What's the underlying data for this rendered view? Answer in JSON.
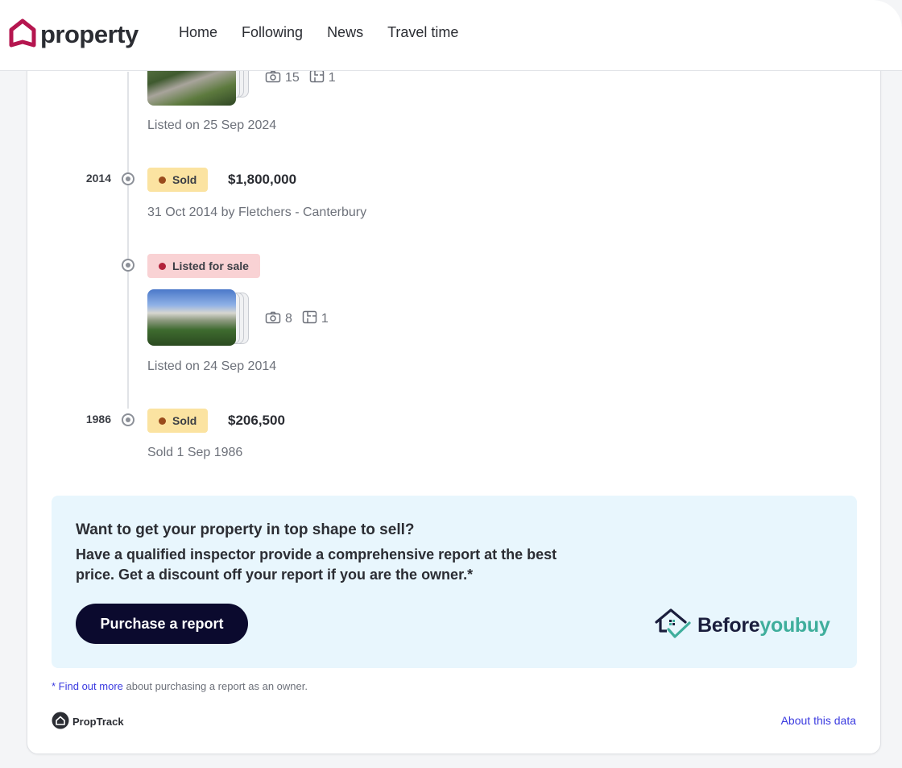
{
  "header": {
    "logo_text": "property",
    "nav": [
      "Home",
      "Following",
      "News",
      "Travel time"
    ]
  },
  "timeline": {
    "top_entry": {
      "photo_count": "15",
      "floorplan_count": "1",
      "listed_text": "Listed on 25 Sep 2024"
    },
    "sold_2014": {
      "year": "2014",
      "badge": "Sold",
      "price": "$1,800,000",
      "detail": "31 Oct 2014 by Fletchers - Canterbury"
    },
    "listed_2014": {
      "badge": "Listed for sale",
      "photo_count": "8",
      "floorplan_count": "1",
      "listed_text": "Listed on 24 Sep 2014"
    },
    "sold_1986": {
      "year": "1986",
      "badge": "Sold",
      "price": "$206,500",
      "detail": "Sold 1 Sep 1986"
    }
  },
  "promo": {
    "title": "Want to get your property in top shape to sell?",
    "body": "Have a qualified inspector provide a comprehensive report at the best price. Get a discount off your report if you are the owner.*",
    "button": "Purchase a report",
    "brand_before": "Before",
    "brand_youbuy": "youbuy"
  },
  "footer": {
    "footnote_star": "* ",
    "footnote_link": "Find out more",
    "footnote_rest": " about purchasing a report as an owner.",
    "proptrack": "PropTrack",
    "about_link": "About this data"
  },
  "colors": {
    "brand_magenta": "#b5164f",
    "button_navy": "#0b0a2e",
    "link_blue": "#3b3be0",
    "sold_badge": "#fbe3a1",
    "listed_badge": "#f9d2d4",
    "teal": "#3fae9c"
  }
}
